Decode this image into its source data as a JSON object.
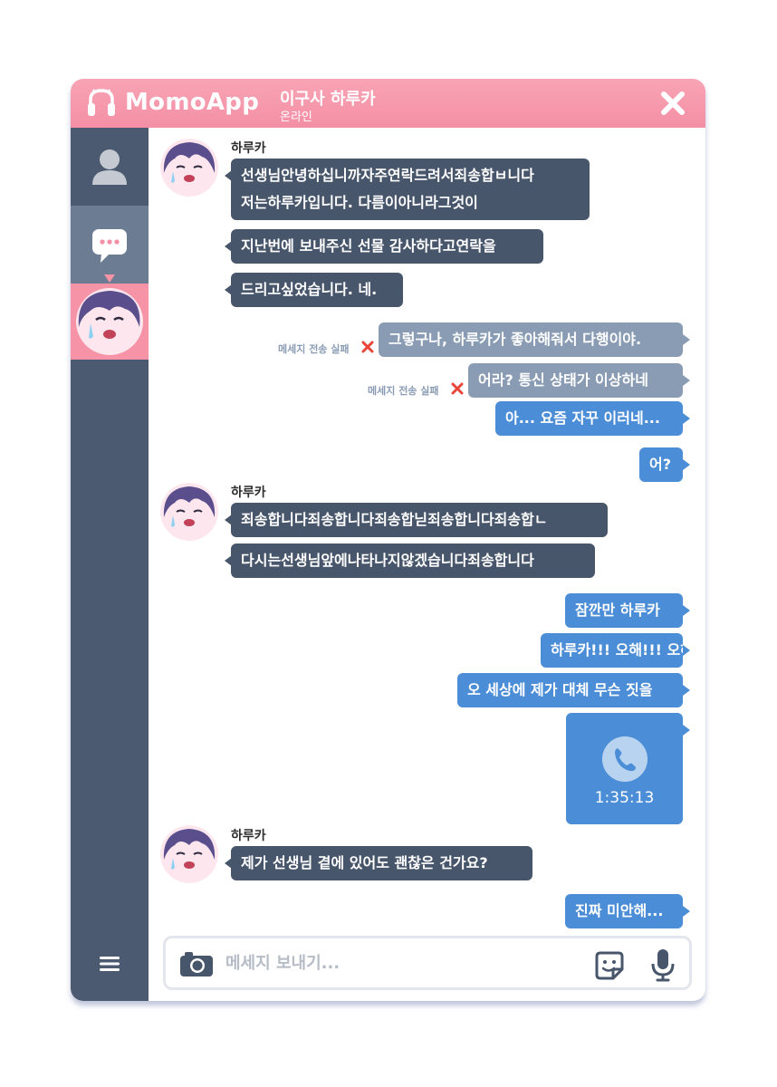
{
  "app": {
    "brand": "MomoApp",
    "chat_title": "이구사 하루카",
    "chat_status": "온라인"
  },
  "colors": {
    "titlebar": "#f48fa5",
    "sidebar": "#4b5a71",
    "incoming_bubble": "#48566c",
    "outgoing_bubble": "#4b8dd6",
    "failed_bubble": "#8a9cb4",
    "fail_icon": "#e8463b"
  },
  "sidebar": {
    "items": [
      {
        "icon": "profile-icon"
      },
      {
        "icon": "chat-bubble-icon"
      },
      {
        "icon": "contact-avatar"
      }
    ],
    "menu_icon": "hamburger-menu-icon"
  },
  "messages": {
    "group1": {
      "sender": "하루카",
      "bubbles": [
        "선생님안녕하십니까자주연락드려서죄송합ㅂ니다",
        "저는하루카입니다. 다름이아니라그것이",
        "지난번에 보내주신 선물 감사하다고연락을",
        "드리고싶었습니다. 네."
      ]
    },
    "sent1": [
      {
        "text": "그렇구나, 하루카가 좋아해줘서 다행이야.",
        "note": "메세지 전송 실패"
      },
      {
        "text": "어라? 통신 상태가 이상하네",
        "note": "메세지 전송 실패"
      },
      {
        "text": "아... 요즘 자꾸 이러네..."
      },
      {
        "text": "어?"
      }
    ],
    "group2": {
      "sender": "하루카",
      "bubbles": [
        "죄송합니다죄송합니다죄송합닏죄송합니다죄송합ㄴ",
        "다시는선생님앞에나타나지않겠습니다죄송합니다"
      ]
    },
    "sent2": [
      {
        "text": "잠깐만 하루카"
      },
      {
        "text": "하루카!!! 오해!!! 오해야!!!"
      },
      {
        "text": "오 세상에 제가 대체 무슨 짓을"
      }
    ],
    "call": {
      "duration": "1:35:13",
      "icon": "phone-icon"
    },
    "group3": {
      "sender": "하루카",
      "bubbles": [
        "제가 선생님 곁에 있어도 괜찮은 건가요?"
      ]
    },
    "sent3": [
      {
        "text": "진짜 미안해..."
      }
    ]
  },
  "composer": {
    "placeholder": "메세지 보내기...",
    "value": "",
    "icons": [
      "camera-icon",
      "sticker-icon",
      "microphone-icon"
    ]
  }
}
